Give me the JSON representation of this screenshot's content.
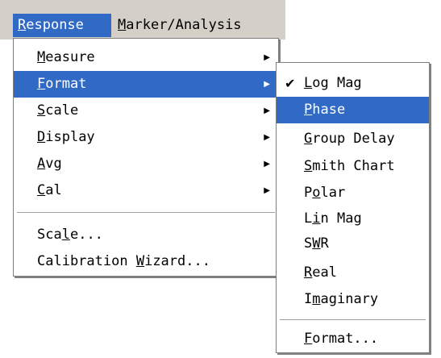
{
  "menubar": {
    "items": [
      {
        "pre": "",
        "acc": "R",
        "post": "esponse"
      },
      {
        "pre": "",
        "acc": "M",
        "post": "arker/Analysis"
      }
    ]
  },
  "response_menu": {
    "items": [
      {
        "pre": "",
        "acc": "M",
        "post": "easure",
        "submenu": true
      },
      {
        "pre": "",
        "acc": "F",
        "post": "ormat",
        "submenu": true
      },
      {
        "pre": "",
        "acc": "S",
        "post": "cale",
        "submenu": true
      },
      {
        "pre": "",
        "acc": "D",
        "post": "isplay",
        "submenu": true
      },
      {
        "pre": "",
        "acc": "A",
        "post": "vg",
        "submenu": true
      },
      {
        "pre": "",
        "acc": "C",
        "post": "al",
        "submenu": true
      },
      {
        "pre": "Sca",
        "acc": "l",
        "post": "e..."
      },
      {
        "pre": "Calibration ",
        "acc": "W",
        "post": "izard..."
      }
    ]
  },
  "format_submenu": {
    "items": [
      {
        "pre": "",
        "acc": "L",
        "post": "og Mag",
        "checked": true
      },
      {
        "pre": "",
        "acc": "P",
        "post": "hase"
      },
      {
        "pre": "",
        "acc": "G",
        "post": "roup Delay"
      },
      {
        "pre": "",
        "acc": "S",
        "post": "mith Chart"
      },
      {
        "pre": "P",
        "acc": "o",
        "post": "lar"
      },
      {
        "pre": "L",
        "acc": "i",
        "post": "n Mag"
      },
      {
        "pre": "S",
        "acc": "W",
        "post": "R"
      },
      {
        "pre": "",
        "acc": "R",
        "post": "eal"
      },
      {
        "pre": "I",
        "acc": "m",
        "post": "aginary"
      },
      {
        "pre": "",
        "acc": "F",
        "post": "ormat..."
      }
    ]
  },
  "icons": {
    "submenu_arrow": "triangle-right-icon",
    "checkmark": "checkmark-icon"
  },
  "colors": {
    "highlight": "#316ac5",
    "menubar_bg": "#d4d0c8"
  }
}
